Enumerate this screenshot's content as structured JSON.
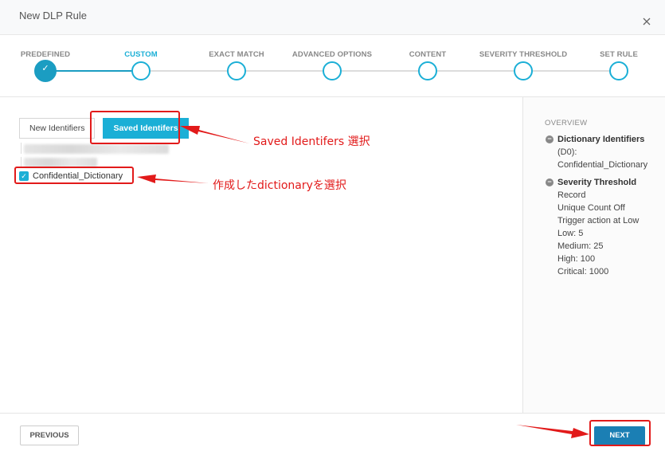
{
  "dialog": {
    "title": "New DLP Rule"
  },
  "steps": [
    {
      "label": "PREDEFINED",
      "state": "done"
    },
    {
      "label": "CUSTOM",
      "state": "active"
    },
    {
      "label": "EXACT MATCH",
      "state": "todo"
    },
    {
      "label": "ADVANCED OPTIONS",
      "state": "todo"
    },
    {
      "label": "CONTENT",
      "state": "todo"
    },
    {
      "label": "SEVERITY THRESHOLD",
      "state": "todo"
    },
    {
      "label": "SET RULE",
      "state": "todo"
    }
  ],
  "tabs": {
    "new_identifiers": "New Identifiers",
    "saved_identifiers": "Saved Identifers"
  },
  "identifier_list": {
    "selected_item": "Confidential_Dictionary",
    "checked": true
  },
  "overview": {
    "title": "OVERVIEW",
    "dictionary": {
      "heading": "Dictionary Identifiers",
      "lines": [
        "(D0):",
        "Confidential_Dictionary"
      ]
    },
    "severity": {
      "heading": "Severity Threshold",
      "lines": [
        "Record",
        "Unique Count Off",
        "Trigger action at Low",
        "Low: 5",
        "Medium: 25",
        "High: 100",
        "Critical: 1000"
      ]
    }
  },
  "footer": {
    "previous": "PREVIOUS",
    "next": "NEXT"
  },
  "annotations": {
    "saved_callout": "Saved Identifers 選択",
    "dictionary_callout": "作成したdictionaryを選択",
    "color": "#e21a1a"
  },
  "colors": {
    "accent": "#1bafd6",
    "primary_button": "#1b7fb4"
  }
}
